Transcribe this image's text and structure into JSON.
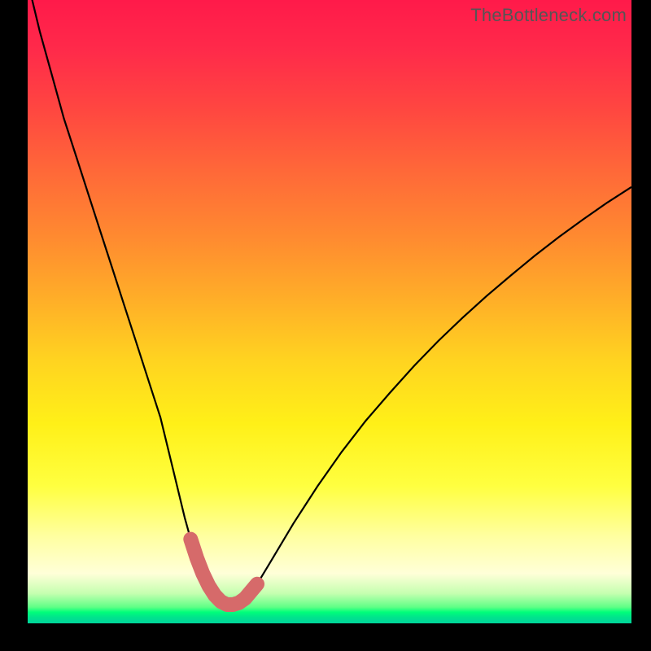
{
  "watermark": "TheBottleneck.com",
  "colors": {
    "background_black": "#000000",
    "curve": "#000000",
    "highlight": "#d66a6a"
  },
  "chart_data": {
    "type": "line",
    "title": "",
    "xlabel": "",
    "ylabel": "",
    "xlim": [
      0,
      100
    ],
    "ylim": [
      0,
      100
    ],
    "grid": false,
    "series": [
      {
        "name": "curve",
        "x": [
          0,
          2,
          4,
          6,
          8,
          10,
          12,
          14,
          16,
          18,
          20,
          22,
          24,
          25,
          26,
          27,
          28,
          29,
          30,
          31,
          32,
          33,
          34,
          35,
          36,
          38,
          40,
          44,
          48,
          52,
          56,
          60,
          64,
          68,
          72,
          76,
          80,
          84,
          88,
          92,
          96,
          100
        ],
        "y": [
          103,
          95,
          88,
          81,
          75,
          69,
          63,
          57,
          51,
          45,
          39,
          33,
          25,
          21,
          17,
          13.5,
          10.5,
          8,
          6,
          4.5,
          3.5,
          3,
          3,
          3.3,
          4,
          6.3,
          9.5,
          16,
          22,
          27.5,
          32.5,
          37,
          41.3,
          45.3,
          49,
          52.5,
          55.8,
          59,
          62,
          64.8,
          67.5,
          70
        ]
      }
    ],
    "highlight_region": {
      "series": "curve",
      "x_start": 27,
      "x_end": 38,
      "note": "rounded pink stroke overlay near the curve minimum"
    }
  }
}
